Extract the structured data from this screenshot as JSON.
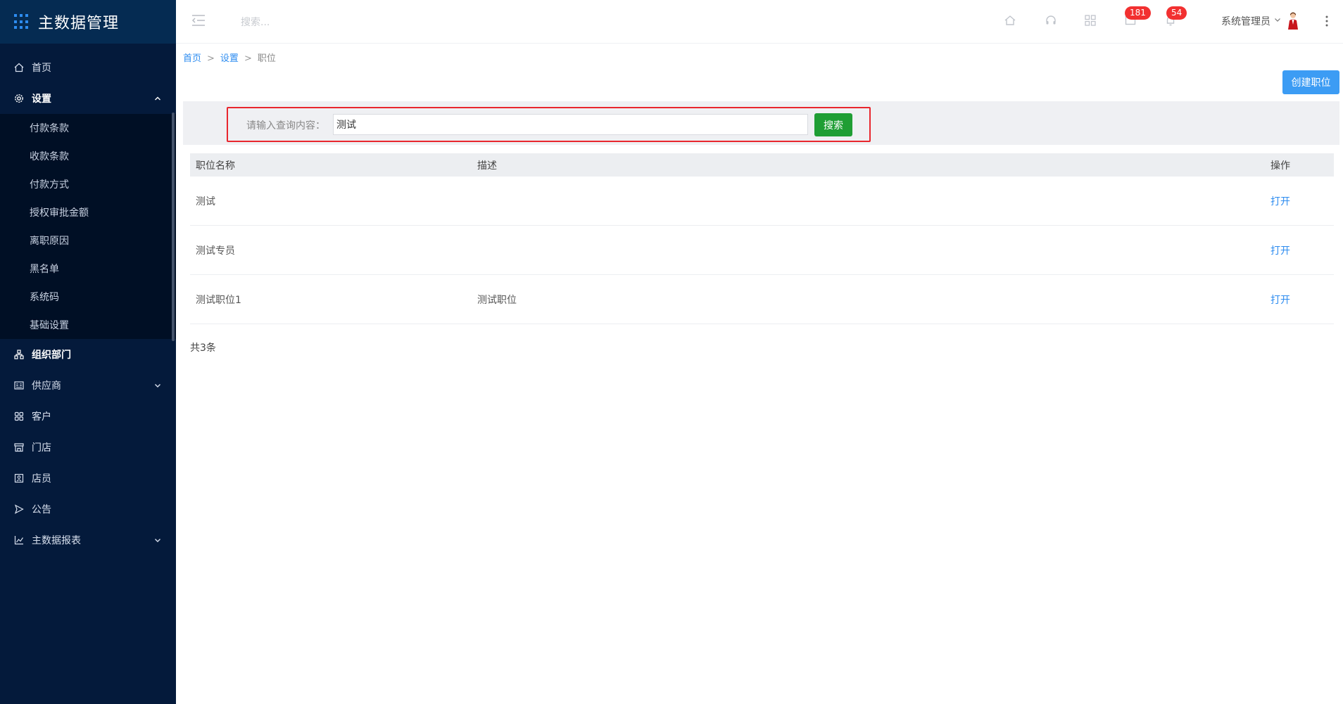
{
  "app": {
    "title": "主数据管理"
  },
  "sidebar": {
    "items": [
      {
        "label": "首页",
        "icon": "home-icon"
      },
      {
        "label": "设置",
        "icon": "gear-icon",
        "expanded": true
      },
      {
        "label": "组织部门",
        "icon": "org-icon"
      },
      {
        "label": "供应商",
        "icon": "supplier-icon"
      },
      {
        "label": "客户",
        "icon": "customer-icon"
      },
      {
        "label": "门店",
        "icon": "store-icon"
      },
      {
        "label": "店员",
        "icon": "staff-icon"
      },
      {
        "label": "公告",
        "icon": "announce-icon"
      },
      {
        "label": "主数据报表",
        "icon": "chart-icon"
      }
    ],
    "settings_sub": [
      "付款条款",
      "收款条款",
      "付款方式",
      "授权审批金额",
      "离职原因",
      "黑名单",
      "系统码",
      "基础设置"
    ]
  },
  "topbar": {
    "search_placeholder": "搜索...",
    "badge_messages": "181",
    "badge_notifications": "54",
    "user_name": "系统管理员"
  },
  "breadcrumb": {
    "home": "首页",
    "settings": "设置",
    "sep": ">",
    "current": "职位"
  },
  "toolbar": {
    "create_label": "创建职位"
  },
  "search": {
    "label": "请输入查询内容：",
    "value": "测试",
    "button_label": "搜索"
  },
  "table": {
    "headers": [
      "职位名称",
      "描述",
      "操作"
    ],
    "rows": [
      {
        "name": "测试",
        "desc": "",
        "action": "打开"
      },
      {
        "name": "测试专员",
        "desc": "",
        "action": "打开"
      },
      {
        "name": "测试职位1",
        "desc": "测试职位",
        "action": "打开"
      }
    ],
    "total": "共3条"
  },
  "colors": {
    "sidebar_bg": "#041a3b",
    "accent_blue": "#2d8cf0",
    "search_green": "#1f9e34",
    "badge_red": "#f23030",
    "highlight_red": "#e8262d"
  }
}
